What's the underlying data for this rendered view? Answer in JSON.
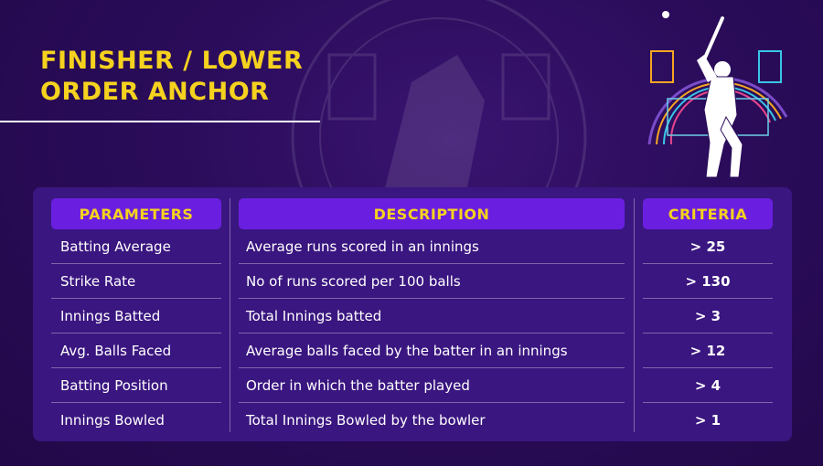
{
  "title": {
    "line1": "FINISHER / LOWER",
    "line2": "ORDER ANCHOR"
  },
  "colors": {
    "accent": "#f5d21e",
    "header_bg": "#6a1fe0",
    "panel_bg": "#3a1680",
    "page_bg": "#2a0c5a"
  },
  "hero_icon": "cricket-batter-illustration",
  "table": {
    "headers": {
      "parameters": "PARAMETERS",
      "description": "DESCRIPTION",
      "criteria": "CRITERIA"
    },
    "rows": [
      {
        "parameter": "Batting Average",
        "description": "Average runs scored in an innings",
        "criteria": "> 25"
      },
      {
        "parameter": "Strike Rate",
        "description": "No of runs scored per 100 balls",
        "criteria": "> 130"
      },
      {
        "parameter": "Innings Batted",
        "description": "Total Innings batted",
        "criteria": "> 3"
      },
      {
        "parameter": "Avg. Balls Faced",
        "description": "Average balls faced by the batter in an innings",
        "criteria": "> 12"
      },
      {
        "parameter": "Batting Position",
        "description": "Order in which the batter played",
        "criteria": "> 4"
      },
      {
        "parameter": "Innings Bowled",
        "description": "Total Innings Bowled by the bowler",
        "criteria": "> 1"
      }
    ]
  }
}
